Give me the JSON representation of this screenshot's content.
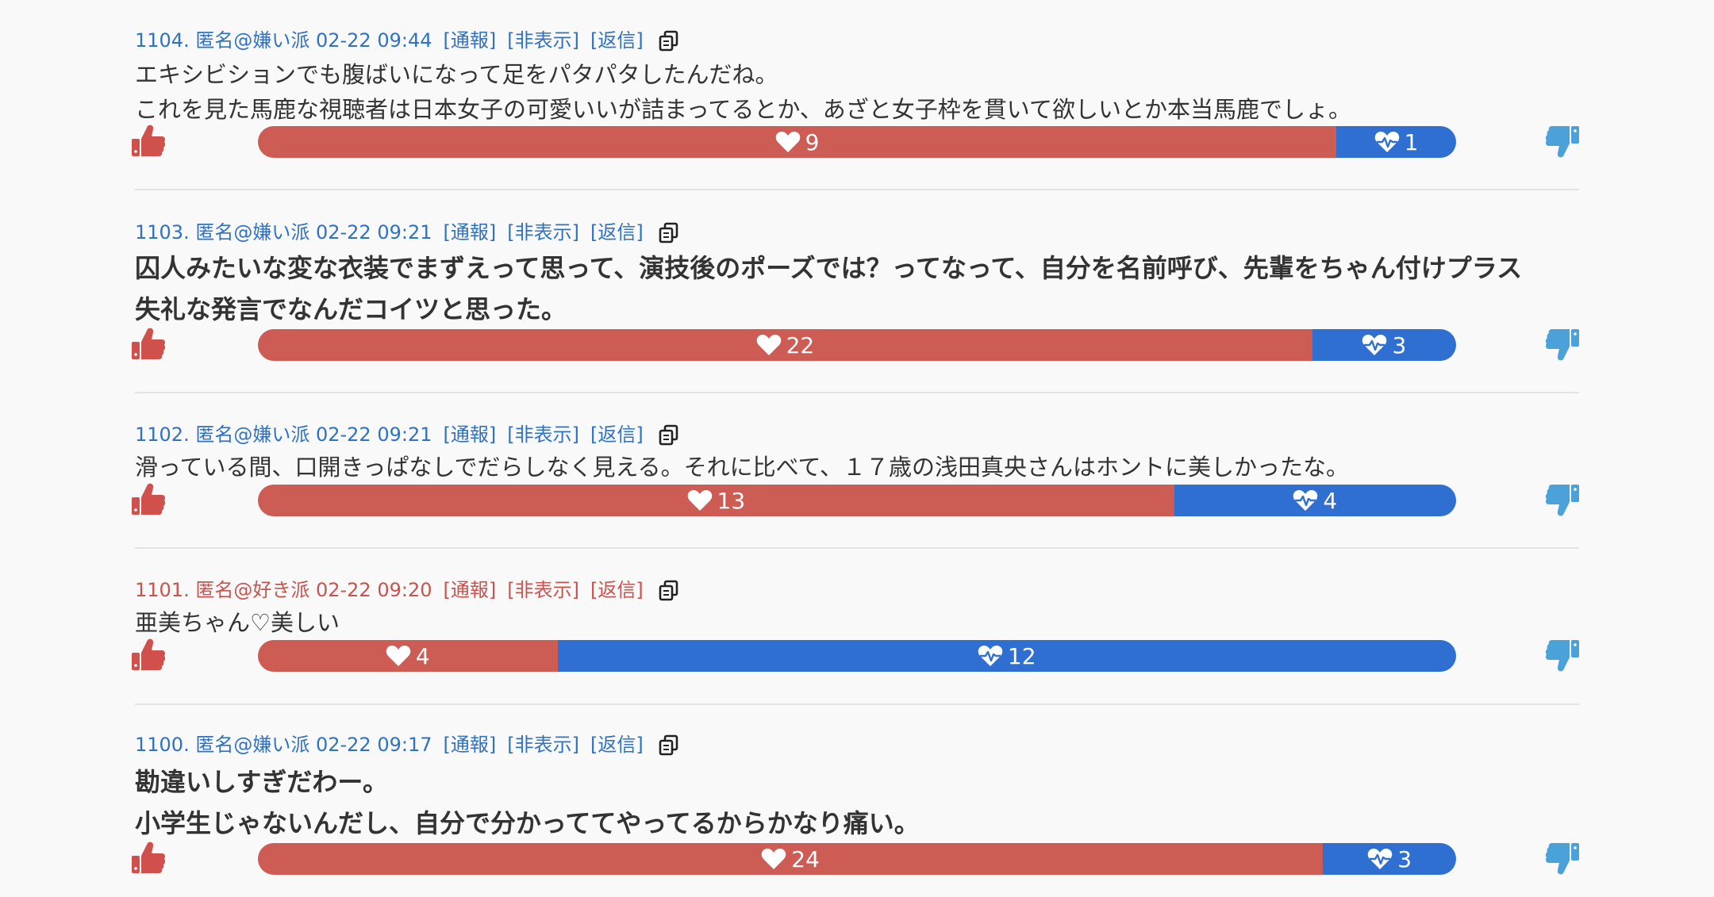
{
  "colors": {
    "kirai_name": "#2f72c4",
    "suki_name": "#c9544f",
    "like_bar": "#cd5c55",
    "dislike_bar": "#2f6fd1",
    "thumb_up": "#d0504b",
    "thumb_down": "#4aa2d8"
  },
  "actions": {
    "report": "[通報]",
    "hide": "[非表示]",
    "reply": "[返信]"
  },
  "posts": [
    {
      "meta": "1104. 匿名@嫌い派 02-22 09:44",
      "faction": "kirai",
      "lines": [
        "エキシビションでも腹ばいになって足をパタパタしたんだね。",
        "これを見た馬鹿な視聴者は日本女子の可愛いいが詰まってるとか、あざと女子枠を貫いて欲しいとか本当馬鹿でしょ。"
      ],
      "bold": false,
      "likes": 9,
      "dislikes": 1
    },
    {
      "meta": "1103. 匿名@嫌い派 02-22 09:21",
      "faction": "kirai",
      "lines": [
        "囚人みたいな変な衣装でまずえって思って、演技後のポーズでは？ってなって、自分を名前呼び、先輩をちゃん付けプラス",
        "失礼な発言でなんだコイツと思った。"
      ],
      "bold": true,
      "likes": 22,
      "dislikes": 3
    },
    {
      "meta": "1102. 匿名@嫌い派 02-22 09:21",
      "faction": "kirai",
      "lines": [
        "滑っている間、口開きっぱなしでだらしなく見える。それに比べて、１７歳の浅田真央さんはホントに美しかったな。"
      ],
      "bold": false,
      "likes": 13,
      "dislikes": 4
    },
    {
      "meta": "1101. 匿名@好き派 02-22 09:20",
      "faction": "suki",
      "lines": [
        "亜美ちゃん♡美しい"
      ],
      "bold": false,
      "likes": 4,
      "dislikes": 12
    },
    {
      "meta": "1100. 匿名@嫌い派 02-22 09:17",
      "faction": "kirai",
      "lines": [
        "勘違いしすぎだわー。",
        "小学生じゃないんだし、自分で分かっててやってるからかなり痛い。"
      ],
      "bold": true,
      "likes": 24,
      "dislikes": 3
    }
  ]
}
